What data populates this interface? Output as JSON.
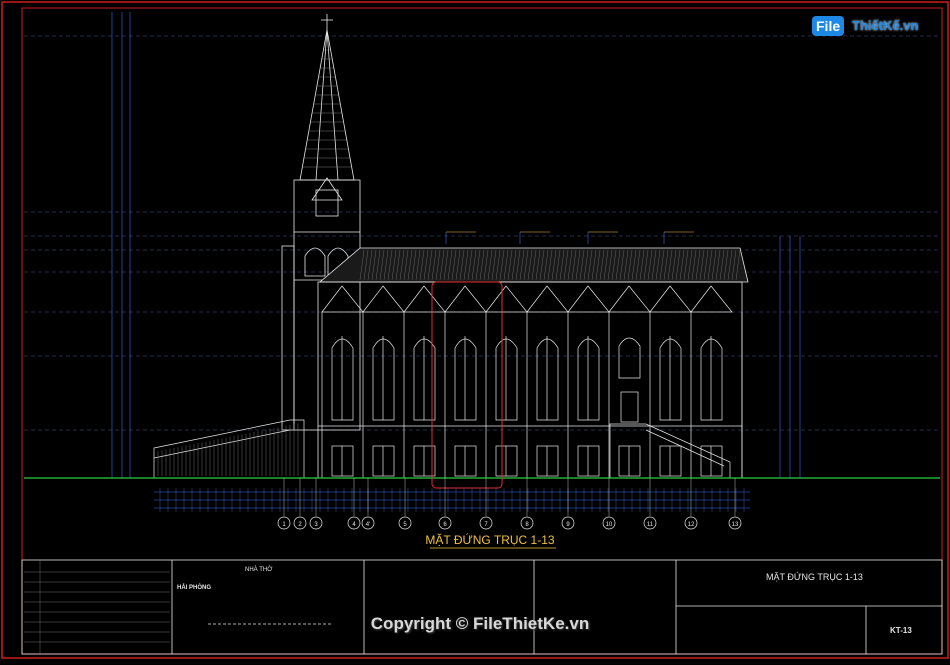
{
  "drawing": {
    "elevation_title": "MẶT ĐỨNG TRỤC 1-13",
    "axis_labels": [
      "1",
      "2",
      "3",
      "4",
      "4'",
      "5",
      "6",
      "7",
      "8",
      "9",
      "10",
      "11",
      "12",
      "13"
    ]
  },
  "title_block": {
    "project": "NHÀ THỜ",
    "location": "HẢI PHÒNG",
    "sheet_title": "MẶT ĐỨNG TRỤC 1-13",
    "sheet_code": "KT-13"
  },
  "watermark": {
    "logo_file": "File",
    "logo_rest": "ThiếtKế.vn",
    "copyright": "Copyright © FileThietKe.vn"
  },
  "colors": {
    "frame": "#d01c1c",
    "lines": "#e8e8e8",
    "dim_blue": "#3a6df0",
    "ground": "#2ecc40",
    "title_yellow": "#f0c040",
    "highlight": "#e03030"
  }
}
